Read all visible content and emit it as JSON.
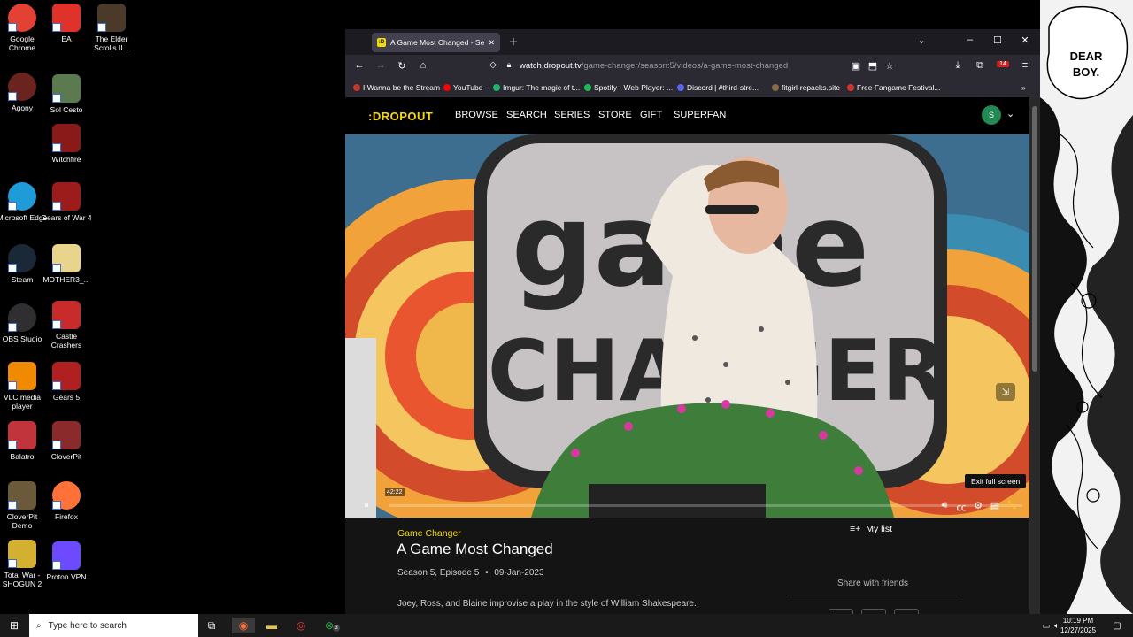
{
  "desktop": {
    "icons": [
      {
        "label": "Google Chrome",
        "icon": "chrome-icon",
        "color": "#e34133"
      },
      {
        "label": "EA",
        "icon": "ea-icon",
        "color": "#e0322a"
      },
      {
        "label": "The Elder Scrolls II...",
        "icon": "elder-scrolls-icon",
        "color": "#4b3a2a"
      },
      {
        "label": "Agony",
        "icon": "agony-icon",
        "color": "#6b2320"
      },
      {
        "label": "Sol Cesto",
        "icon": "sol-cesto-icon",
        "color": "#5b7a50"
      },
      {
        "label": "Witchfire",
        "icon": "witchfire-icon",
        "color": "#8a1a1a"
      },
      {
        "label": "Microsoft Edge",
        "icon": "edge-icon",
        "color": "#1f9bd7"
      },
      {
        "label": "Gears of War 4",
        "icon": "gears-icon",
        "color": "#9c1c1c"
      },
      {
        "label": "Steam",
        "icon": "steam-icon",
        "color": "#1b2838"
      },
      {
        "label": "MOTHER3_...",
        "icon": "folder-icon",
        "color": "#e8d48a"
      },
      {
        "label": "OBS Studio",
        "icon": "obs-icon",
        "color": "#302e31"
      },
      {
        "label": "Castle Crashers",
        "icon": "castle-crashers-icon",
        "color": "#c92a2a"
      },
      {
        "label": "VLC media player",
        "icon": "vlc-icon",
        "color": "#f08a00"
      },
      {
        "label": "Gears 5",
        "icon": "gears-icon",
        "color": "#b02020"
      },
      {
        "label": "Balatro",
        "icon": "balatro-icon",
        "color": "#c2343b"
      },
      {
        "label": "CloverPit",
        "icon": "cloverpit-icon",
        "color": "#8a2a2a"
      },
      {
        "label": "CloverPit Demo",
        "icon": "cloverpit-demo-icon",
        "color": "#6a5a3a"
      },
      {
        "label": "Firefox",
        "icon": "firefox-icon",
        "color": "#ff7139"
      },
      {
        "label": "Total War - SHOGUN 2",
        "icon": "shogun-icon",
        "color": "#d4b030"
      },
      {
        "label": "Proton VPN",
        "icon": "proton-vpn-icon",
        "color": "#6d4aff"
      }
    ]
  },
  "artwork": {
    "speech": [
      "DEAR",
      "BOY."
    ]
  },
  "browser": {
    "tab_title": "A Game Most Changed - Seaso",
    "tab_favicon_text": ":D",
    "url_domain": "watch.dropout.tv",
    "url_path": "/game-changer/season:5/videos/a-game-most-changed",
    "extension_badge": "14",
    "bookmarks": [
      {
        "label": "I Wanna be the Stream",
        "color": "#c0392b"
      },
      {
        "label": "YouTube",
        "color": "#ff0000"
      },
      {
        "label": "Imgur: The magic of t...",
        "color": "#1bb76e"
      },
      {
        "label": "Spotify - Web Player: ...",
        "color": "#1db954"
      },
      {
        "label": "Discord | #third-stre...",
        "color": "#5865f2"
      },
      {
        "label": "fitgirl-repacks.site",
        "color": "#8a6a4a"
      },
      {
        "label": "Free Fangame Festival...",
        "color": "#d0342c"
      }
    ]
  },
  "site": {
    "logo": ":DROPOUT",
    "nav": [
      "BROWSE",
      "SEARCH",
      "SERIES",
      "STORE",
      "GIFT",
      "SUPERFAN"
    ],
    "avatar_initial": "S",
    "player": {
      "time_label": "42:22",
      "progress": 0.0,
      "tooltip": "Exit full screen"
    },
    "show_name": "Game Changer",
    "episode_title": "A Game Most Changed",
    "season_episode": "Season 5, Episode 5",
    "separator": "•",
    "air_date": "09-Jan-2023",
    "description": "Joey, Ross, and Blaine improvise a play in the style of William Shakespeare.",
    "my_list_label": "My list",
    "share_label": "Share with friends"
  },
  "taskbar": {
    "search_placeholder": "Type here to search",
    "time": "10:19 PM",
    "date": "12/27/2025",
    "xbox_badge": "3"
  }
}
